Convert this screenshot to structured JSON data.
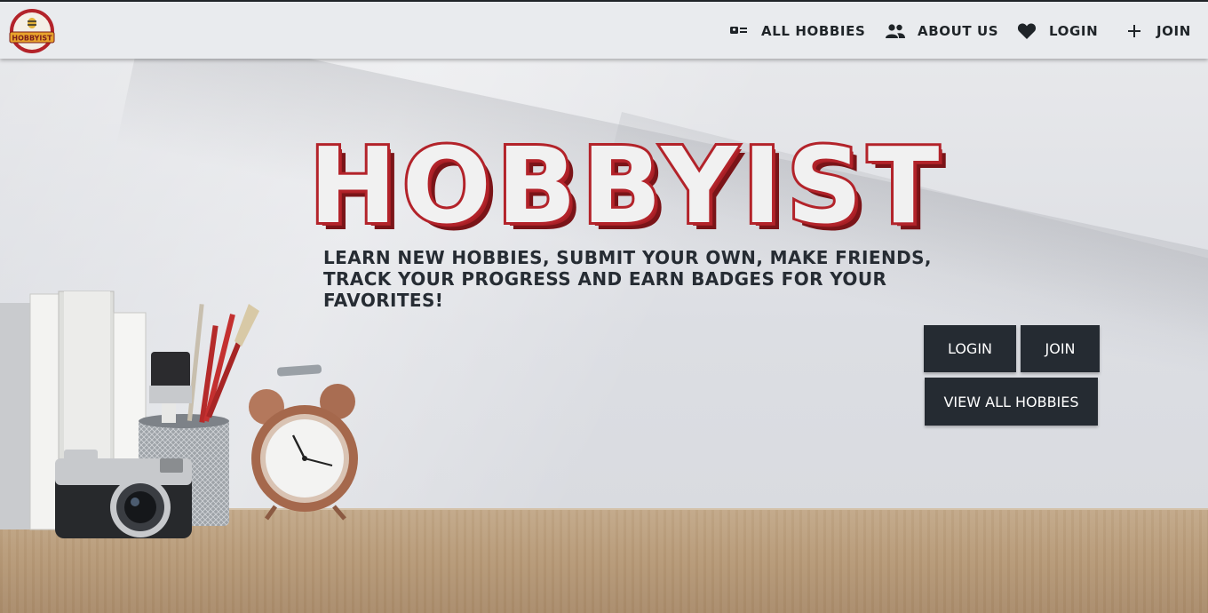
{
  "brand": {
    "logo_text": "HOBBYIST",
    "accent_color": "#b3232a"
  },
  "nav": {
    "items": [
      {
        "label": "All Hobbies",
        "icon": "id-card-icon"
      },
      {
        "label": "About Us",
        "icon": "people-icon"
      },
      {
        "label": "Login",
        "icon": "heart-icon"
      },
      {
        "label": "Join",
        "icon": "plus-icon"
      }
    ]
  },
  "hero": {
    "title": "HOBBYIST",
    "tagline": "Learn new hobbies, submit your own, make friends, track your progress and earn badges for your favorites!",
    "buttons": {
      "login": "LOGIN",
      "join": "JOIN",
      "view_all": "VIEW ALL HOBBIES"
    }
  },
  "colors": {
    "button_bg": "#252b32",
    "text_dark": "#262c33",
    "title_red": "#b3232a"
  }
}
